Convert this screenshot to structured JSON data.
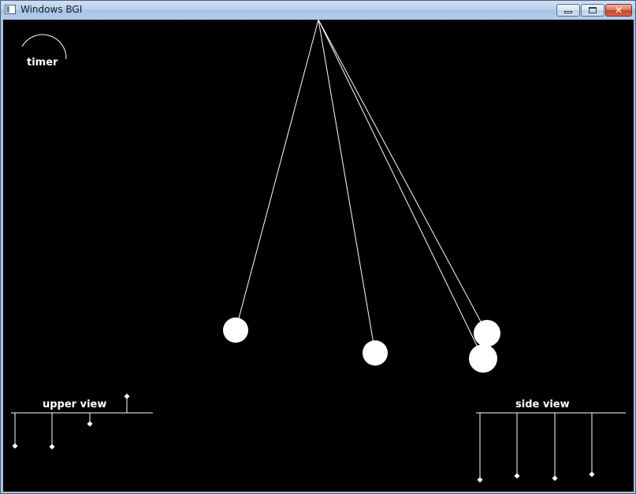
{
  "window": {
    "title": "Windows BGI",
    "icon": "bgi-window-icon",
    "buttons": {
      "minimize_icon": "minimize-icon",
      "maximize_icon": "maximize-icon",
      "close_icon": "close-icon"
    }
  },
  "canvas": {
    "background": "#000000",
    "foreground": "#ffffff",
    "timer_label": "timer",
    "upper_view_label": "upper view",
    "side_view_label": "side view"
  }
}
